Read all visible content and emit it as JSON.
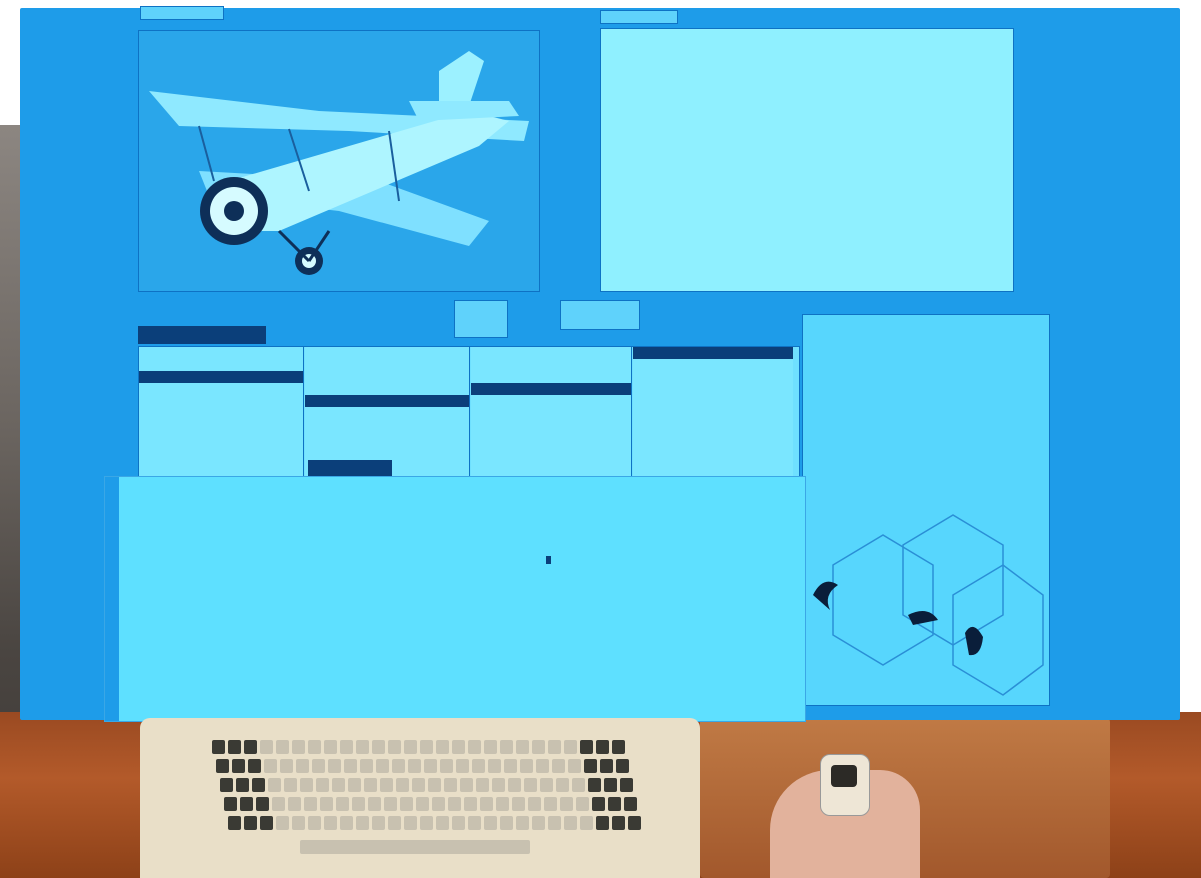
{
  "screen": {
    "plane_window": {
      "title": ""
    },
    "document_window": {
      "tab_label": "",
      "lines": [
        "",
        "",
        "",
        "",
        "",
        "",
        "",
        "",
        "",
        "",
        ""
      ]
    },
    "browser_window": {
      "title": "",
      "panes": [
        {
          "items": [
            "",
            "",
            "",
            "",
            "",
            "",
            "",
            ""
          ],
          "selected": 2
        },
        {
          "items": [
            "",
            "",
            "",
            "",
            "",
            "",
            ""
          ],
          "selected": 4
        },
        {
          "items": [
            "",
            "",
            "",
            "",
            "",
            "",
            ""
          ],
          "selected": 3
        },
        {
          "items": [
            "",
            "",
            "",
            "",
            ""
          ],
          "selected": 0
        }
      ],
      "tab_labels": [
        "",
        ""
      ]
    },
    "code_window": {
      "lines": [
        "",
        "",
        "",
        "",
        "",
        "",
        "",
        ""
      ]
    }
  },
  "colors": {
    "screen": "#1e9ce9",
    "window": "#3cc1f2",
    "highlight": "#0b3f7a",
    "desk": "#a24f24",
    "keyboard": "#e9dfc8"
  },
  "icons": [
    "airplane-image",
    "cube-diagram",
    "keyboard",
    "mouse"
  ]
}
